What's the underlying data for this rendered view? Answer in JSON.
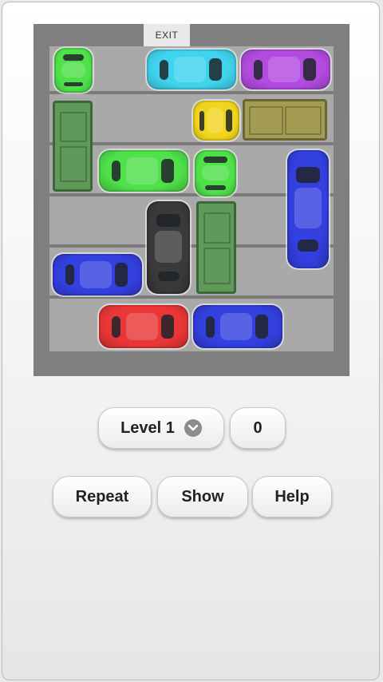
{
  "board": {
    "exit_label": "EXIT",
    "colors": {
      "board": "#7f7f7f",
      "lot": "#a9a9a9"
    },
    "vehicles": [
      {
        "name": "green-car-top-left",
        "kind": "car",
        "color": "#4fe04a"
      },
      {
        "name": "cyan-car",
        "kind": "car",
        "color": "#3fd4ee"
      },
      {
        "name": "purple-car",
        "kind": "car",
        "color": "#b24be0"
      },
      {
        "name": "green-truck-left",
        "kind": "truck",
        "color": "#5f9a5a"
      },
      {
        "name": "yellow-car",
        "kind": "car",
        "color": "#f1d51d"
      },
      {
        "name": "olive-truck",
        "kind": "truck",
        "color": "#a39c52"
      },
      {
        "name": "green-car-middle",
        "kind": "car",
        "color": "#4fe04a"
      },
      {
        "name": "green-car-small",
        "kind": "car",
        "color": "#4fe04a"
      },
      {
        "name": "blue-car-right",
        "kind": "car",
        "color": "#3340e0"
      },
      {
        "name": "black-car",
        "kind": "car",
        "color": "#3a3a3a"
      },
      {
        "name": "green-truck-center",
        "kind": "truck",
        "color": "#5f9a5a"
      },
      {
        "name": "blue-car-left",
        "kind": "car",
        "color": "#3340e0"
      },
      {
        "name": "red-car",
        "kind": "car",
        "color": "#ea3636"
      },
      {
        "name": "blue-car-bottom",
        "kind": "car",
        "color": "#3340e0"
      }
    ]
  },
  "controls": {
    "level_label": "Level 1",
    "move_count": "0",
    "repeat_label": "Repeat",
    "show_label": "Show",
    "help_label": "Help"
  }
}
